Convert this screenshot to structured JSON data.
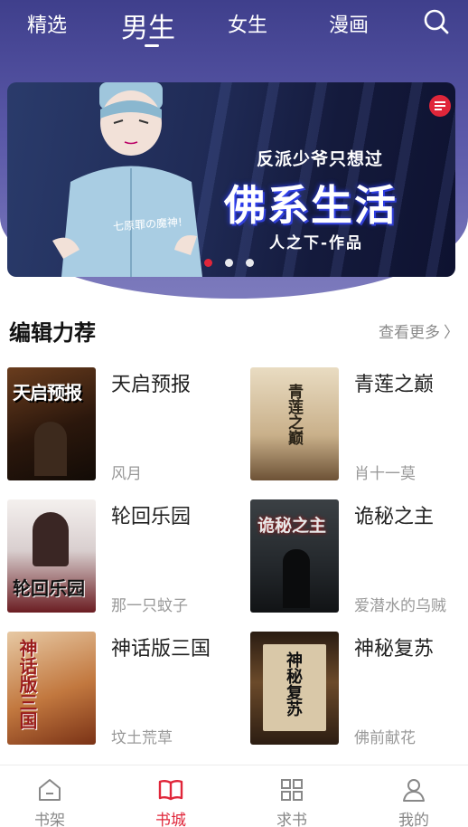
{
  "top_tabs": [
    {
      "label": "精选",
      "active": false
    },
    {
      "label": "男生",
      "active": true
    },
    {
      "label": "女生",
      "active": false
    },
    {
      "label": "漫画",
      "active": false
    }
  ],
  "banner": {
    "subtitle": "反派少爷只想过",
    "title": "佛系生活",
    "author": "人之下-作品",
    "tag": "七原罪の魔神!",
    "dots": 3,
    "active_dot": 0
  },
  "section": {
    "title": "编辑力荐",
    "more_label": "查看更多"
  },
  "books": [
    {
      "title": "天启预报",
      "author": "风月",
      "cover_text": "天启预报"
    },
    {
      "title": "青莲之巅",
      "author": "肖十一莫",
      "cover_text": "青莲之巅"
    },
    {
      "title": "轮回乐园",
      "author": "那一只蚊子",
      "cover_text": "轮回乐园"
    },
    {
      "title": "诡秘之主",
      "author": "爱潜水的乌贼",
      "cover_text": "诡秘之主"
    },
    {
      "title": "神话版三国",
      "author": "坟土荒草",
      "cover_text": "神话版三国"
    },
    {
      "title": "神秘复苏",
      "author": "佛前献花",
      "cover_text": "神秘复苏"
    }
  ],
  "bottom_nav": [
    {
      "label": "书架",
      "icon": "bookshelf-icon",
      "active": false
    },
    {
      "label": "书城",
      "icon": "open-book-icon",
      "active": true
    },
    {
      "label": "求书",
      "icon": "grid-icon",
      "active": false
    },
    {
      "label": "我的",
      "icon": "person-icon",
      "active": false
    }
  ],
  "colors": {
    "accent": "#e0263a",
    "header": "#4a4896"
  }
}
